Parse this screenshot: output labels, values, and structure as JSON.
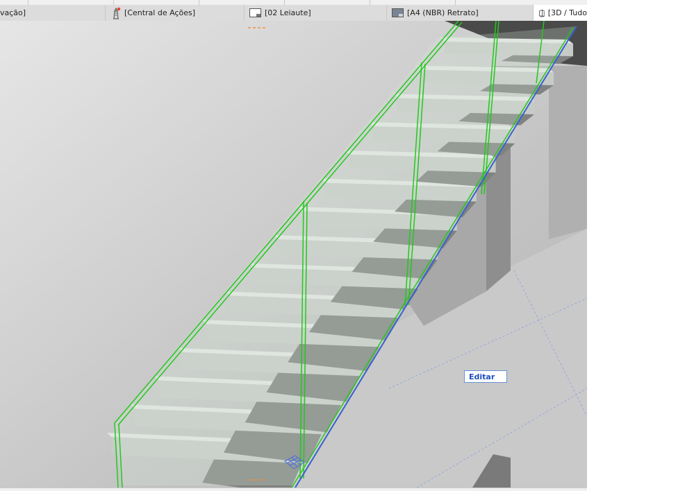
{
  "tabs": [
    {
      "label": "vação]",
      "icon": "elevation-icon"
    },
    {
      "label": "[Central de Ações]",
      "icon": "lighthouse-icon"
    },
    {
      "label": "[02 Leiaute]",
      "icon": "layout-icon"
    },
    {
      "label": "[A4 (NBR) Retrato]",
      "icon": "sheet-icon"
    },
    {
      "label": "[3D / Tudo",
      "icon": "cube-3d-icon"
    }
  ],
  "viewport": {
    "context_label": "Editar"
  },
  "colors": {
    "railing": "#22c81e",
    "selection": "#3a5fd0",
    "notification": "#e8402a",
    "marker": "#f0903a"
  }
}
